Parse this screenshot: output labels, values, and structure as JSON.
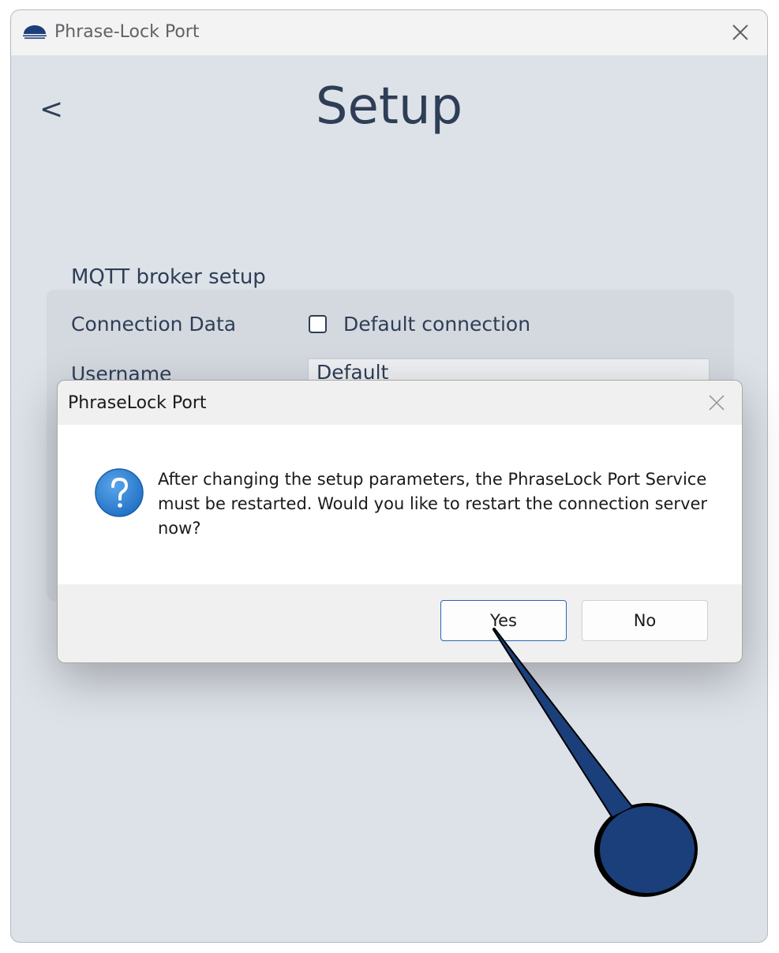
{
  "window": {
    "title": "Phrase-Lock Port"
  },
  "page": {
    "back_label": "<",
    "title": "Setup"
  },
  "broker": {
    "section_title": "MQTT broker setup",
    "connection_label": "Connection Data",
    "default_connection_label": "Default connection",
    "default_connection_checked": false,
    "username_label": "Username",
    "username_value": "Default"
  },
  "dialog": {
    "title": "PhraseLock Port",
    "message": "After changing the setup parameters, the PhraseLock Port Service must be restarted. Would you like to restart the connection server now?",
    "yes_label": "Yes",
    "no_label": "No",
    "icon": "question-icon"
  },
  "colors": {
    "accent": "#2e63b8",
    "pointer": "#1b3f7a",
    "text": "#2f3e56"
  }
}
